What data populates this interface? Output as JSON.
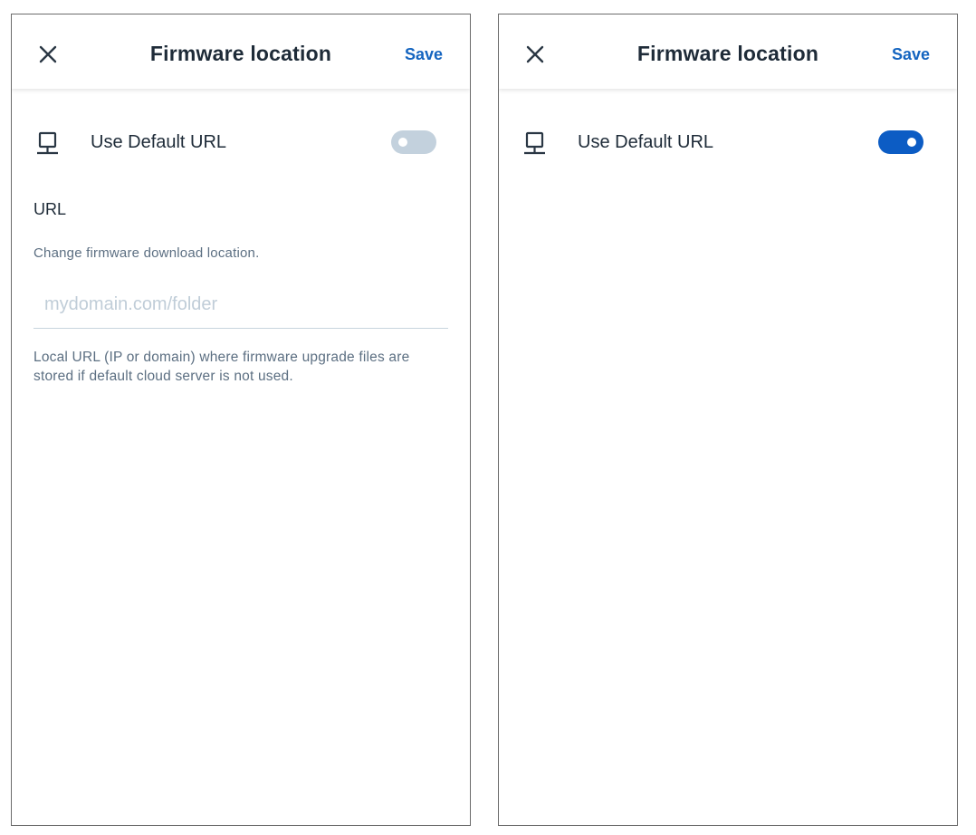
{
  "screens": [
    {
      "header": {
        "title": "Firmware location",
        "save_label": "Save",
        "close_icon": "close-icon"
      },
      "default_url": {
        "label": "Use Default URL",
        "icon": "computer-icon",
        "enabled": false
      },
      "url_section": {
        "heading": "URL",
        "description": "Change firmware download location.",
        "input_placeholder": "mydomain.com/folder",
        "input_value": "",
        "help_text": "Local URL (IP or domain) where firmware upgrade files are stored if default cloud server is not used."
      }
    },
    {
      "header": {
        "title": "Firmware location",
        "save_label": "Save",
        "close_icon": "close-icon"
      },
      "default_url": {
        "label": "Use Default URL",
        "icon": "computer-icon",
        "enabled": true
      }
    }
  ],
  "colors": {
    "accent": "#1565c0",
    "toggle_on": "#0c5cc4",
    "toggle_off": "#c3d1dd",
    "text_primary": "#1e2b38",
    "text_secondary": "#5c6f82",
    "placeholder": "#c0cdd8"
  }
}
